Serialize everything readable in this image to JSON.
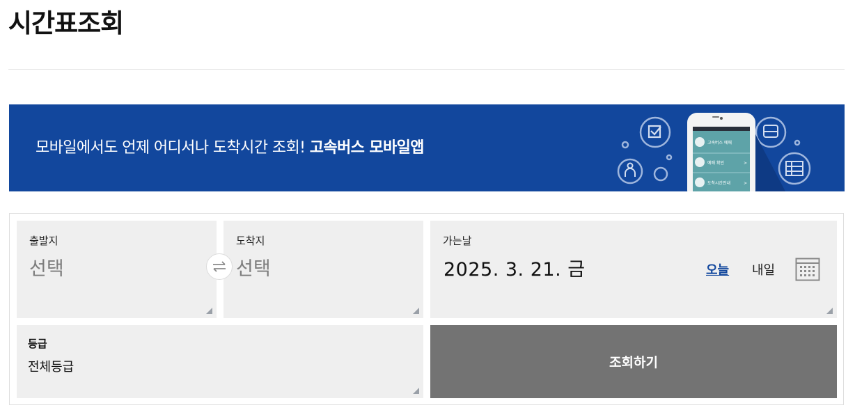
{
  "page": {
    "title": "시간표조회"
  },
  "banner": {
    "text": "모바일에서도 언제 어디서나 도착시간 조회!",
    "highlight": "고속버스 모바일앱",
    "phone_menu": [
      "고속버스 예매",
      "예매 확인",
      "도착시간안내"
    ],
    "color": "#12479d"
  },
  "search": {
    "departure": {
      "label": "출발지",
      "value": "선택"
    },
    "arrival": {
      "label": "도착지",
      "value": "선택"
    },
    "swap_icon": "swap-arrows-icon",
    "date": {
      "label": "가는날",
      "value": "2025. 3. 21. 금",
      "today": "오늘",
      "tomorrow": "내일",
      "calendar_icon": "calendar-icon"
    },
    "grade": {
      "label": "등급",
      "value": "전체등급"
    },
    "submit": "조회하기",
    "button_color": "#737373"
  }
}
